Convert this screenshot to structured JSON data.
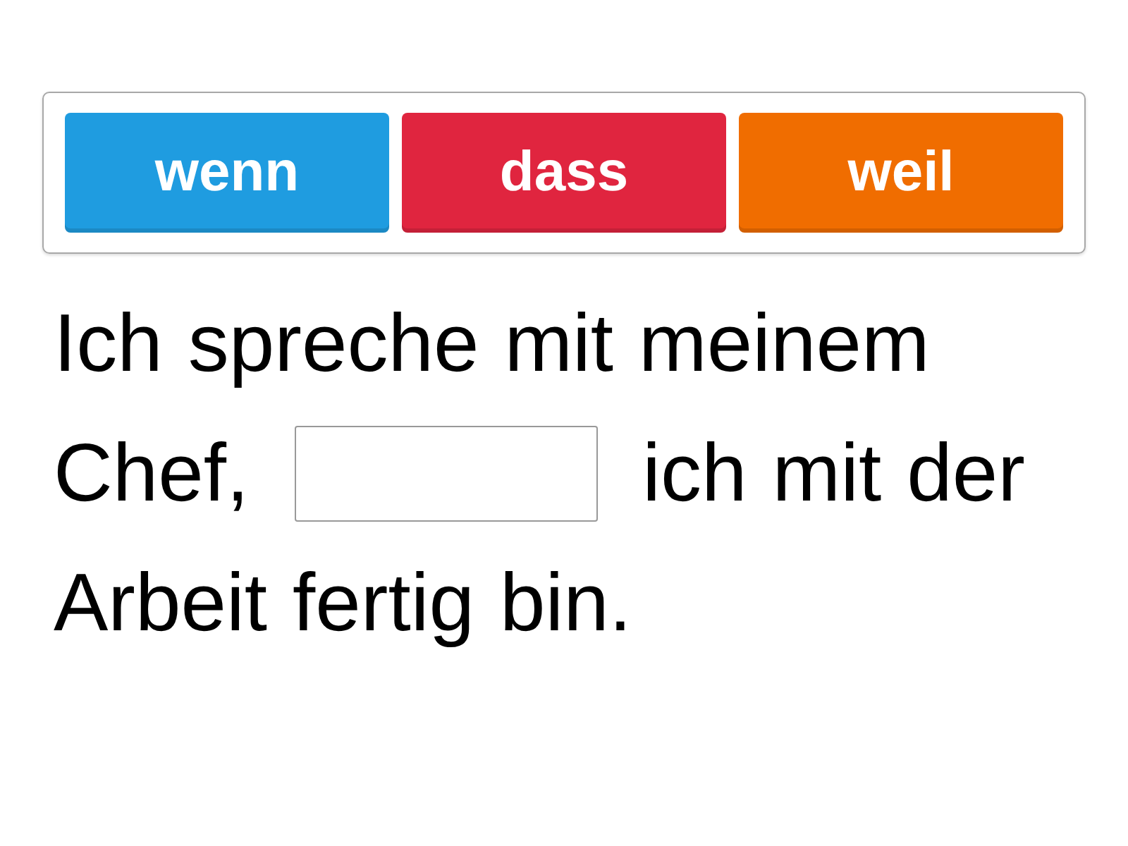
{
  "options": [
    {
      "label": "wenn",
      "color": "#1f9ce0"
    },
    {
      "label": "dass",
      "color": "#e0253f"
    },
    {
      "label": "weil",
      "color": "#f06d00"
    }
  ],
  "sentence": [
    {
      "kind": "word",
      "text": "Ich"
    },
    {
      "kind": "word",
      "text": "spreche"
    },
    {
      "kind": "word",
      "text": "mit"
    },
    {
      "kind": "word",
      "text": "meinem"
    },
    {
      "kind": "word",
      "text": "Chef,"
    },
    {
      "kind": "blank"
    },
    {
      "kind": "word",
      "text": "ich"
    },
    {
      "kind": "word",
      "text": "mit"
    },
    {
      "kind": "word",
      "text": "der"
    },
    {
      "kind": "word",
      "text": "Arbeit"
    },
    {
      "kind": "word",
      "text": "fertig"
    },
    {
      "kind": "word",
      "text": "bin."
    }
  ]
}
